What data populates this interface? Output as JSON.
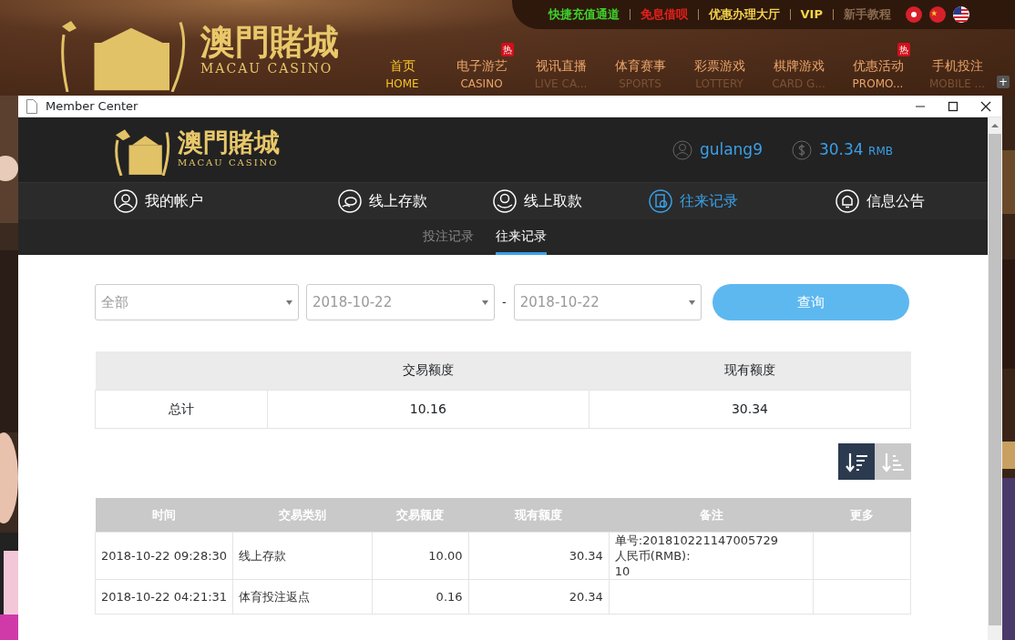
{
  "site": {
    "logo_title": "澳門賭城",
    "logo_subtitle": "MACAU CASINO",
    "top_links": [
      {
        "label": "快捷充值通道",
        "color": "#3fd22c"
      },
      {
        "label": "免息借呗",
        "color": "#e8201c"
      },
      {
        "label": "优惠办理大厅",
        "color": "#f2d24a"
      },
      {
        "label": "VIP",
        "color": "#f2d24a"
      },
      {
        "label": "新手教程",
        "color": "#8a6a50"
      }
    ],
    "nav": [
      {
        "label": "首页",
        "sublabel": "HOME",
        "selected": true,
        "hot": false
      },
      {
        "label": "电子游艺",
        "sublabel": "CASINO",
        "selected": false,
        "hot": true,
        "badge": "热"
      },
      {
        "label": "视讯直播",
        "sublabel": "LIVE CA...",
        "selected": false,
        "hot": false
      },
      {
        "label": "体育赛事",
        "sublabel": "SPORTS",
        "selected": false,
        "hot": false
      },
      {
        "label": "彩票游戏",
        "sublabel": "LOTTERY",
        "selected": false,
        "hot": false
      },
      {
        "label": "棋牌游戏",
        "sublabel": "CARD G...",
        "selected": false,
        "hot": false
      },
      {
        "label": "优惠活动",
        "sublabel": "PROMO...",
        "selected": false,
        "hot": true,
        "badge": "热"
      },
      {
        "label": "手机投注",
        "sublabel": "MOBILE ...",
        "selected": false,
        "hot": false
      }
    ],
    "expand": "+"
  },
  "window": {
    "title": "Member Center"
  },
  "member": {
    "logo_title": "澳門賭城",
    "logo_subtitle": "MACAU CASINO",
    "username": "gulang9",
    "balance": "30.34",
    "currency": "RMB",
    "nav": [
      {
        "label": "我的帐户",
        "selected": false
      },
      {
        "label": "线上存款",
        "selected": false
      },
      {
        "label": "线上取款",
        "selected": false
      },
      {
        "label": "往来记录",
        "selected": true
      },
      {
        "label": "信息公告",
        "selected": false
      }
    ],
    "subtabs": [
      {
        "label": "投注记录",
        "selected": false
      },
      {
        "label": "往来记录",
        "selected": true
      }
    ]
  },
  "filters": {
    "type": "全部",
    "date_from": "2018-10-22",
    "separator": "-",
    "date_to": "2018-10-22",
    "query": "查询"
  },
  "summary": {
    "columns": [
      "",
      "交易额度",
      "现有额度"
    ],
    "rows": [
      [
        "总计",
        "10.16",
        "30.34"
      ]
    ]
  },
  "sort_buttons": [
    {
      "kind": "desc",
      "selected": true
    },
    {
      "kind": "asc",
      "selected": false
    }
  ],
  "table": {
    "columns": [
      "时间",
      "交易类别",
      "交易额度",
      "现有额度",
      "备注",
      "更多"
    ],
    "rows": [
      {
        "time": "2018-10-22 09:28:30",
        "type": "线上存款",
        "amount": "10.00",
        "balance": "30.34",
        "note": [
          "单号:201810221147005729",
          "人民币(RMB):",
          "10"
        ]
      },
      {
        "time": "2018-10-22 04:21:31",
        "type": "体育投注返点",
        "amount": "0.16",
        "balance": "20.34",
        "note": []
      }
    ]
  }
}
